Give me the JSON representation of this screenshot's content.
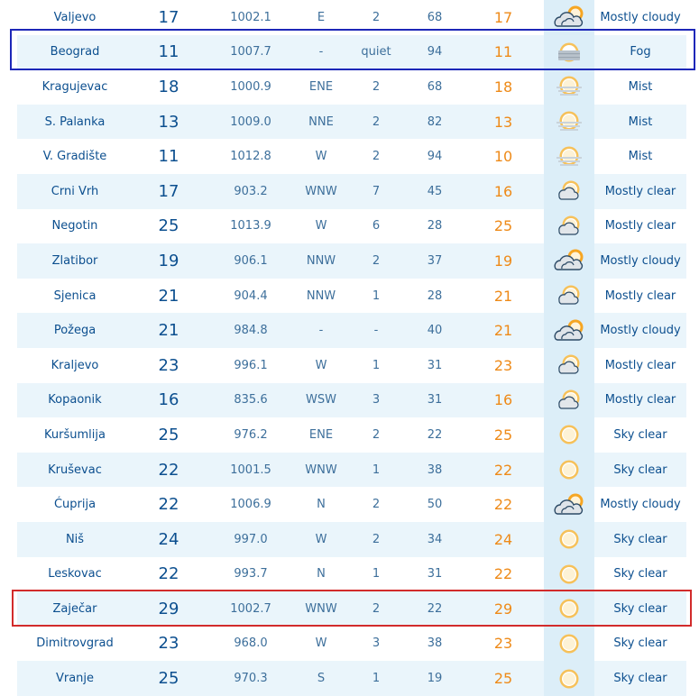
{
  "table": {
    "rows": [
      {
        "city": "Valjevo",
        "temp": "17",
        "pressure": "1002.1",
        "wind_dir": "E",
        "wind_speed": "2",
        "humidity": "68",
        "feels": "17",
        "icon": "mostly-cloudy-icon",
        "desc": "Mostly cloudy"
      },
      {
        "city": "Beograd",
        "temp": "11",
        "pressure": "1007.7",
        "wind_dir": "-",
        "wind_speed": "quiet",
        "humidity": "94",
        "feels": "11",
        "icon": "fog-icon",
        "desc": "Fog"
      },
      {
        "city": "Kragujevac",
        "temp": "18",
        "pressure": "1000.9",
        "wind_dir": "ENE",
        "wind_speed": "2",
        "humidity": "68",
        "feels": "18",
        "icon": "mist-icon",
        "desc": "Mist"
      },
      {
        "city": "S. Palanka",
        "temp": "13",
        "pressure": "1009.0",
        "wind_dir": "NNE",
        "wind_speed": "2",
        "humidity": "82",
        "feels": "13",
        "icon": "mist-icon",
        "desc": "Mist"
      },
      {
        "city": "V. Gradište",
        "temp": "11",
        "pressure": "1012.8",
        "wind_dir": "W",
        "wind_speed": "2",
        "humidity": "94",
        "feels": "10",
        "icon": "mist-icon",
        "desc": "Mist"
      },
      {
        "city": "Crni Vrh",
        "temp": "17",
        "pressure": "903.2",
        "wind_dir": "WNW",
        "wind_speed": "7",
        "humidity": "45",
        "feels": "16",
        "icon": "mostly-clear-icon",
        "desc": "Mostly clear"
      },
      {
        "city": "Negotin",
        "temp": "25",
        "pressure": "1013.9",
        "wind_dir": "W",
        "wind_speed": "6",
        "humidity": "28",
        "feels": "25",
        "icon": "mostly-clear-icon",
        "desc": "Mostly clear"
      },
      {
        "city": "Zlatibor",
        "temp": "19",
        "pressure": "906.1",
        "wind_dir": "NNW",
        "wind_speed": "2",
        "humidity": "37",
        "feels": "19",
        "icon": "mostly-cloudy-icon",
        "desc": "Mostly cloudy"
      },
      {
        "city": "Sjenica",
        "temp": "21",
        "pressure": "904.4",
        "wind_dir": "NNW",
        "wind_speed": "1",
        "humidity": "28",
        "feels": "21",
        "icon": "mostly-clear-icon",
        "desc": "Mostly clear"
      },
      {
        "city": "Požega",
        "temp": "21",
        "pressure": "984.8",
        "wind_dir": "-",
        "wind_speed": "-",
        "humidity": "40",
        "feels": "21",
        "icon": "mostly-cloudy-icon",
        "desc": "Mostly cloudy"
      },
      {
        "city": "Kraljevo",
        "temp": "23",
        "pressure": "996.1",
        "wind_dir": "W",
        "wind_speed": "1",
        "humidity": "31",
        "feels": "23",
        "icon": "mostly-clear-icon",
        "desc": "Mostly clear"
      },
      {
        "city": "Kopaonik",
        "temp": "16",
        "pressure": "835.6",
        "wind_dir": "WSW",
        "wind_speed": "3",
        "humidity": "31",
        "feels": "16",
        "icon": "mostly-clear-icon",
        "desc": "Mostly clear"
      },
      {
        "city": "Kuršumlija",
        "temp": "25",
        "pressure": "976.2",
        "wind_dir": "ENE",
        "wind_speed": "2",
        "humidity": "22",
        "feels": "25",
        "icon": "sun-icon",
        "desc": "Sky clear"
      },
      {
        "city": "Kruševac",
        "temp": "22",
        "pressure": "1001.5",
        "wind_dir": "WNW",
        "wind_speed": "1",
        "humidity": "38",
        "feels": "22",
        "icon": "sun-icon",
        "desc": "Sky clear"
      },
      {
        "city": "Ćuprija",
        "temp": "22",
        "pressure": "1006.9",
        "wind_dir": "N",
        "wind_speed": "2",
        "humidity": "50",
        "feels": "22",
        "icon": "mostly-cloudy-icon",
        "desc": "Mostly cloudy"
      },
      {
        "city": "Niš",
        "temp": "24",
        "pressure": "997.0",
        "wind_dir": "W",
        "wind_speed": "2",
        "humidity": "34",
        "feels": "24",
        "icon": "sun-icon",
        "desc": "Sky clear"
      },
      {
        "city": "Leskovac",
        "temp": "22",
        "pressure": "993.7",
        "wind_dir": "N",
        "wind_speed": "1",
        "humidity": "31",
        "feels": "22",
        "icon": "sun-icon",
        "desc": "Sky clear"
      },
      {
        "city": "Zaječar",
        "temp": "29",
        "pressure": "1002.7",
        "wind_dir": "WNW",
        "wind_speed": "2",
        "humidity": "22",
        "feels": "29",
        "icon": "sun-icon",
        "desc": "Sky clear"
      },
      {
        "city": "Dimitrovgrad",
        "temp": "23",
        "pressure": "968.0",
        "wind_dir": "W",
        "wind_speed": "3",
        "humidity": "38",
        "feels": "23",
        "icon": "sun-icon",
        "desc": "Sky clear"
      },
      {
        "city": "Vranje",
        "temp": "25",
        "pressure": "970.3",
        "wind_dir": "S",
        "wind_speed": "1",
        "humidity": "19",
        "feels": "25",
        "icon": "sun-icon",
        "desc": "Sky clear"
      }
    ]
  },
  "colors": {
    "city_text": "#0c4f8f",
    "feels_temp": "#ee8a18",
    "row_alt_bg": "#eaf5fb",
    "blue_highlight": "#1d27b8",
    "red_highlight": "#d22b2b"
  },
  "highlights": {
    "blue_row_city": "Beograd",
    "red_row_city": "Zaječar"
  }
}
